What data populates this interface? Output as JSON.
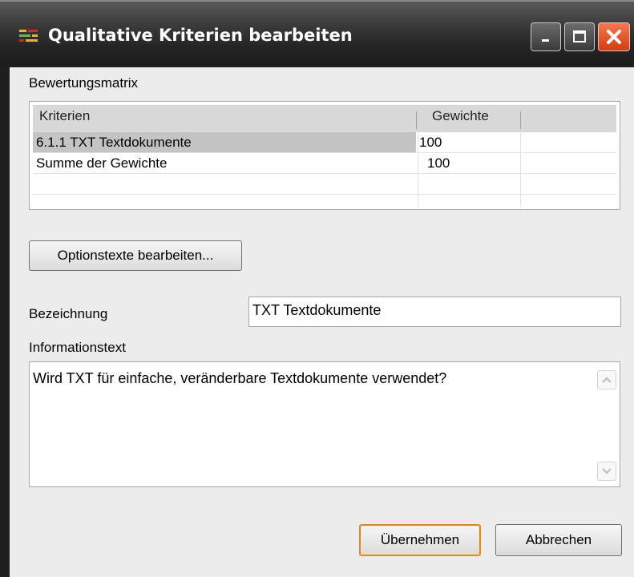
{
  "window": {
    "title": "Qualitative Kriterien bearbeiten"
  },
  "matrix": {
    "label": "Bewertungsmatrix",
    "columns": [
      "Kriterien",
      "Gewichte"
    ],
    "rows": [
      {
        "criterion": "6.1.1 TXT Textdokumente",
        "weight": "100"
      },
      {
        "criterion": "Summe der Gewichte",
        "weight": "100"
      }
    ]
  },
  "options_button": "Optionstexte bearbeiten...",
  "designation": {
    "label": "Bezeichnung",
    "value": "TXT Textdokumente"
  },
  "info": {
    "label": "Informationstext",
    "value": "Wird TXT für einfache, veränderbare Textdokumente verwendet?"
  },
  "buttons": {
    "accept": "Übernehmen",
    "cancel": "Abbrechen"
  },
  "colors": {
    "titlebar": "#2b2b2b",
    "close_button": "#e0501f",
    "default_button_border": "#d48a32"
  }
}
